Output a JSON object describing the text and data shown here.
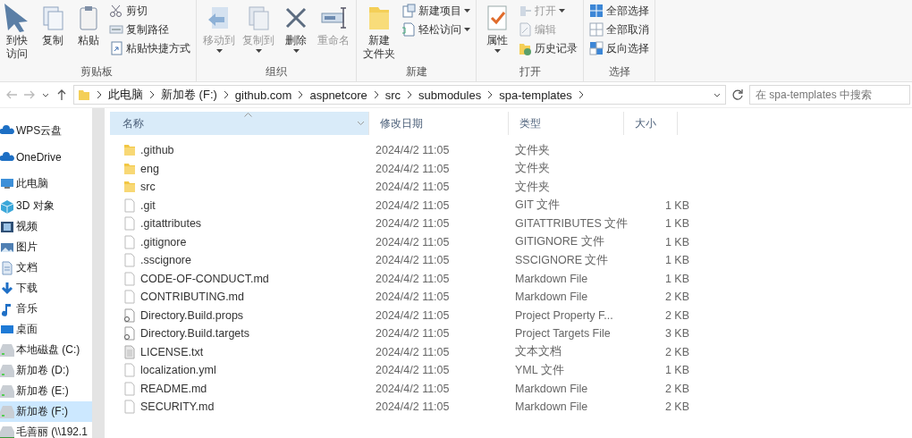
{
  "ribbon": {
    "groups": [
      {
        "label": "剪贴板",
        "large": [
          {
            "lines": [
              "到快",
              "访问"
            ],
            "disabled": false,
            "menu": false
          },
          {
            "lines": [
              "复制"
            ],
            "disabled": false,
            "menu": false
          },
          {
            "lines": [
              "粘贴"
            ],
            "disabled": false,
            "menu": false
          }
        ],
        "small": [
          {
            "label": "剪切",
            "disabled": false,
            "menu": false
          },
          {
            "label": "复制路径",
            "disabled": false,
            "menu": false
          },
          {
            "label": "粘贴快捷方式",
            "disabled": false,
            "menu": false
          }
        ]
      },
      {
        "label": "组织",
        "large": [
          {
            "lines": [
              "移动到"
            ],
            "disabled": true,
            "menu": true
          },
          {
            "lines": [
              "复制到"
            ],
            "disabled": true,
            "menu": true
          },
          {
            "lines": [
              "删除"
            ],
            "disabled": false,
            "menu": true
          },
          {
            "lines": [
              "重命名"
            ],
            "disabled": true,
            "menu": false
          }
        ]
      },
      {
        "label": "新建",
        "large": [
          {
            "lines": [
              "新建",
              "文件夹"
            ],
            "disabled": false,
            "menu": false
          }
        ],
        "small": [
          {
            "label": "新建项目",
            "disabled": false,
            "menu": true
          },
          {
            "label": "轻松访问",
            "disabled": false,
            "menu": true
          }
        ]
      },
      {
        "label": "打开",
        "large": [
          {
            "lines": [
              "属性"
            ],
            "disabled": false,
            "menu": true
          }
        ],
        "small": [
          {
            "label": "打开",
            "disabled": true,
            "menu": true
          },
          {
            "label": "编辑",
            "disabled": true,
            "menu": false
          },
          {
            "label": "历史记录",
            "disabled": false,
            "menu": false
          }
        ]
      },
      {
        "label": "选择",
        "small": [
          {
            "label": "全部选择",
            "disabled": false,
            "menu": false
          },
          {
            "label": "全部取消",
            "disabled": false,
            "menu": false
          },
          {
            "label": "反向选择",
            "disabled": false,
            "menu": false
          }
        ]
      }
    ]
  },
  "address": {
    "path": [
      "此电脑",
      "新加卷 (F:)",
      "github.com",
      "aspnetcore",
      "src",
      "submodules",
      "spa-templates"
    ],
    "search": {
      "placeholder": "在 spa-templates 中搜索"
    }
  },
  "sidebar": {
    "items": [
      {
        "label": "WPS云盘",
        "kind": "cloud",
        "selected": false
      },
      {
        "label": "OneDrive",
        "kind": "cloud",
        "selected": false
      },
      {
        "label": "此电脑",
        "kind": "pc",
        "selected": false
      },
      {
        "label": "3D 对象",
        "kind": "cube",
        "selected": false
      },
      {
        "label": "视频",
        "kind": "video",
        "selected": false
      },
      {
        "label": "图片",
        "kind": "image",
        "selected": false
      },
      {
        "label": "文档",
        "kind": "doc",
        "selected": false
      },
      {
        "label": "下载",
        "kind": "download",
        "selected": false
      },
      {
        "label": "音乐",
        "kind": "music",
        "selected": false
      },
      {
        "label": "桌面",
        "kind": "desktop",
        "selected": false
      },
      {
        "label": "本地磁盘 (C:)",
        "kind": "drive",
        "selected": false
      },
      {
        "label": "新加卷 (D:)",
        "kind": "drive",
        "selected": false
      },
      {
        "label": "新加卷 (E:)",
        "kind": "drive",
        "selected": false
      },
      {
        "label": "新加卷 (F:)",
        "kind": "drive",
        "selected": true
      },
      {
        "label": "毛善丽 (\\\\192.1",
        "kind": "network",
        "selected": false
      }
    ]
  },
  "table": {
    "columns": [
      {
        "label": "名称",
        "sorted": true
      },
      {
        "label": "修改日期",
        "sorted": false
      },
      {
        "label": "类型",
        "sorted": false
      },
      {
        "label": "大小",
        "sorted": false
      }
    ],
    "rows": [
      {
        "kind": "folder",
        "name": ".github",
        "date": "2024/4/2 11:05",
        "type": "文件夹"
      },
      {
        "kind": "folder",
        "name": "eng",
        "date": "2024/4/2 11:05",
        "type": "文件夹"
      },
      {
        "kind": "folder",
        "name": "src",
        "date": "2024/4/2 11:05",
        "type": "文件夹"
      },
      {
        "kind": "file",
        "name": ".git",
        "date": "2024/4/2 11:05",
        "type": "GIT 文件",
        "size": "1 KB"
      },
      {
        "kind": "file",
        "name": ".gitattributes",
        "date": "2024/4/2 11:05",
        "type": "GITATTRIBUTES 文件",
        "size": "1 KB"
      },
      {
        "kind": "file",
        "name": ".gitignore",
        "date": "2024/4/2 11:05",
        "type": "GITIGNORE 文件",
        "size": "1 KB"
      },
      {
        "kind": "file",
        "name": ".sscignore",
        "date": "2024/4/2 11:05",
        "type": "SSCIGNORE 文件",
        "size": "1 KB"
      },
      {
        "kind": "file",
        "name": "CODE-OF-CONDUCT.md",
        "date": "2024/4/2 11:05",
        "type": "Markdown File",
        "size": "1 KB"
      },
      {
        "kind": "file",
        "name": "CONTRIBUTING.md",
        "date": "2024/4/2 11:05",
        "type": "Markdown File",
        "size": "2 KB"
      },
      {
        "kind": "project",
        "name": "Directory.Build.props",
        "date": "2024/4/2 11:05",
        "type": "Project Property F...",
        "size": "2 KB"
      },
      {
        "kind": "project",
        "name": "Directory.Build.targets",
        "date": "2024/4/2 11:05",
        "type": "Project Targets File",
        "size": "3 KB"
      },
      {
        "kind": "text",
        "name": "LICENSE.txt",
        "date": "2024/4/2 11:05",
        "type": "文本文档",
        "size": "2 KB"
      },
      {
        "kind": "file",
        "name": "localization.yml",
        "date": "2024/4/2 11:05",
        "type": "YML 文件",
        "size": "1 KB"
      },
      {
        "kind": "file",
        "name": "README.md",
        "date": "2024/4/2 11:05",
        "type": "Markdown File",
        "size": "2 KB"
      },
      {
        "kind": "file",
        "name": "SECURITY.md",
        "date": "2024/4/2 11:05",
        "type": "Markdown File",
        "size": "2 KB"
      }
    ]
  }
}
